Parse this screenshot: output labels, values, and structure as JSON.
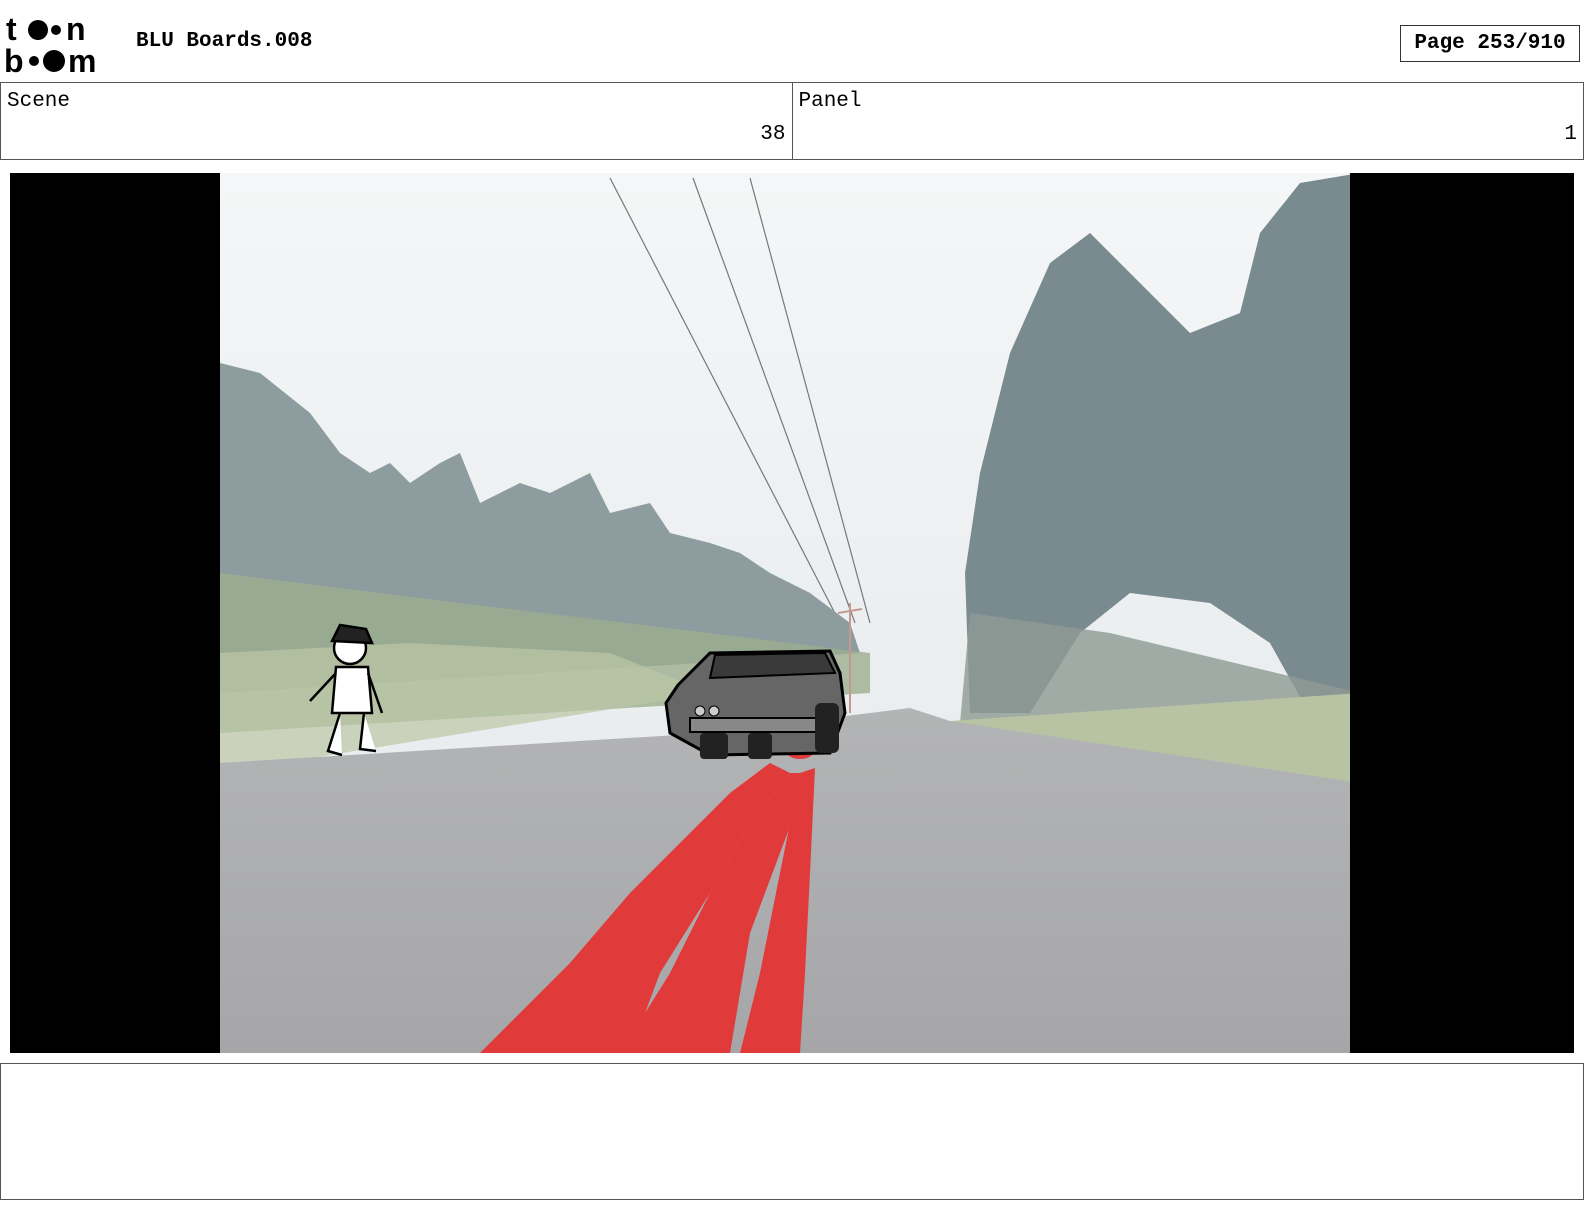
{
  "header": {
    "logo_text_top": "toon",
    "logo_text_bottom": "boom",
    "title": "BLU Boards.008",
    "page_label": "Page 253/910"
  },
  "info": {
    "scene_label": "Scene",
    "scene_value": "38",
    "panel_label": "Panel",
    "panel_value": "1"
  },
  "panel_image": {
    "description_icon": "storyboard-frame-icon",
    "colors": {
      "letterbox": "#000000",
      "sky": "#eef1f2",
      "road": "#a9a9ab",
      "trees": "#7a8a8c",
      "blood": "#e03a3a",
      "car": "#555555"
    }
  },
  "notes": {
    "text": ""
  }
}
